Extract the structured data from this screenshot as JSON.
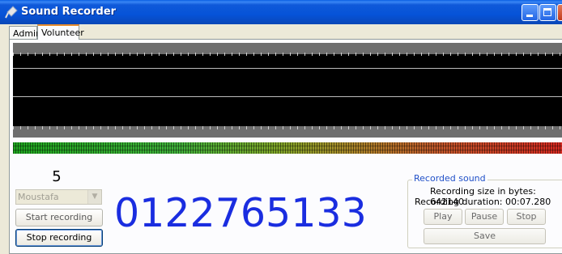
{
  "window": {
    "title": "Sound Recorder"
  },
  "tabs": [
    {
      "label": "Admin"
    },
    {
      "label": "Volunteer"
    }
  ],
  "volunteer": {
    "count": "5",
    "name_select": {
      "selected": "Moustafa"
    },
    "start_label": "Start recording",
    "stop_label": "Stop recording",
    "phone_number": "0122765133"
  },
  "recorded_sound": {
    "group_title": "Recorded sound",
    "size_text": "Recording size in bytes: 642140",
    "duration_text": "Recording duration: 00:07.280",
    "play_label": "Play",
    "pause_label": "Pause",
    "stop_label": "Stop",
    "save_label": "Save"
  },
  "colors": {
    "phone_number": "#1a2de0",
    "title_bar": "#0653d8",
    "group_title": "#2050c8"
  }
}
